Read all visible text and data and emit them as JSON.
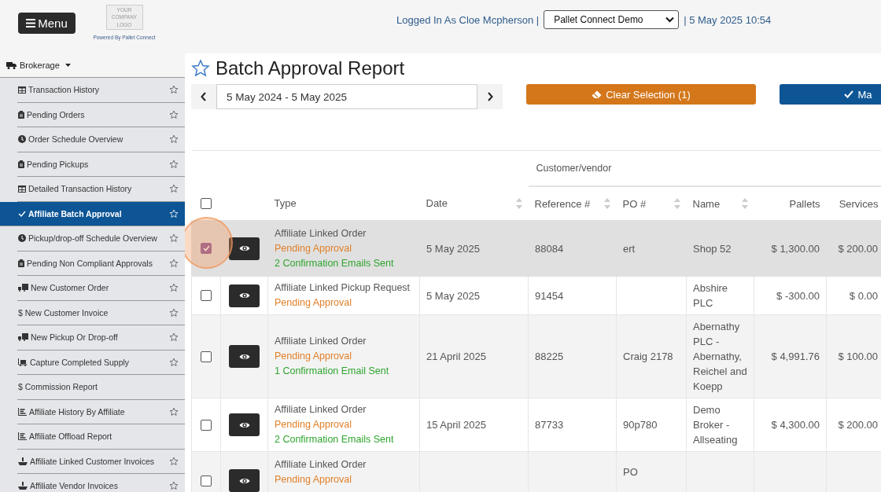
{
  "header": {
    "menu_button": "Menu",
    "logo": "YOUR COMPANY LOGO",
    "powered_by": "Powered By Pallet Connect",
    "logged_in": "Logged In As Cloe Mcpherson |",
    "company_select": "Pallet Connect Demo",
    "datetime": "| 5 May 2025 10:54"
  },
  "sidebar": {
    "section": "Brokerage",
    "items": [
      {
        "label": "Transaction History",
        "kind": "table",
        "star": true,
        "selected": false
      },
      {
        "label": "Pending Orders",
        "kind": "clipboard",
        "star": true,
        "selected": false
      },
      {
        "label": "Order Schedule Overview",
        "kind": "clock",
        "star": true,
        "selected": false
      },
      {
        "label": "Pending Pickups",
        "kind": "clipboard",
        "star": true,
        "selected": false
      },
      {
        "label": "Detailed Transaction History",
        "kind": "table",
        "star": true,
        "selected": false
      },
      {
        "label": "Affiliate Batch Approval",
        "kind": "check",
        "star": true,
        "selected": true
      },
      {
        "label": "Pickup/drop-off Schedule Overview",
        "kind": "clock",
        "star": true,
        "selected": false
      },
      {
        "label": "Pending Non Compliant Approvals",
        "kind": "clipboard",
        "star": true,
        "selected": false
      },
      {
        "label": "New Customer Order",
        "kind": "truck",
        "star": true,
        "selected": false
      },
      {
        "label": "$ New Customer Invoice",
        "kind": "plain",
        "star": true,
        "selected": false
      },
      {
        "label": "New Pickup Or Drop-off",
        "kind": "truck",
        "star": true,
        "selected": false
      },
      {
        "label": "Capture Completed Supply",
        "kind": "cart",
        "star": true,
        "selected": false
      },
      {
        "label": "$ Commission Report",
        "kind": "plain",
        "star": false,
        "selected": false
      },
      {
        "label": "Affiliate History By Affiliate",
        "kind": "chart",
        "star": true,
        "selected": false
      },
      {
        "label": "Affiliate Offload Report",
        "kind": "chart",
        "star": false,
        "selected": false
      },
      {
        "label": "Affiliate Linked Customer Invoices",
        "kind": "ship",
        "star": true,
        "selected": false
      },
      {
        "label": "Affiliate Vendor Invoices",
        "kind": "ship",
        "star": true,
        "selected": false
      }
    ]
  },
  "title": "Batch Approval Report",
  "date_range": "5 May 2024 - 5 May 2025",
  "buttons": [
    {
      "label": "Clear Selection (1)",
      "kind": "clear"
    },
    {
      "label": "Ma",
      "kind": "mark"
    }
  ],
  "table": {
    "group_header": "Customer/vendor",
    "select_all": {
      "checked": false
    },
    "columns": [
      {
        "label": "Type",
        "sortable": false
      },
      {
        "label": "Date",
        "sortable": true
      },
      {
        "label": "Reference #",
        "sortable": true
      },
      {
        "label": "PO #",
        "sortable": true
      },
      {
        "label": "Name",
        "sortable": true
      },
      {
        "label": "Pallets",
        "sortable": false
      },
      {
        "label": "Services",
        "sortable": false
      }
    ],
    "rows": [
      {
        "selected": true,
        "cells": [
          [
            {
              "text": "Affiliate Linked Order",
              "kind": "type"
            },
            {
              "text": "Pending Approval",
              "kind": "status"
            },
            {
              "text": "2 Confirmation Emails Sent",
              "kind": "emails"
            }
          ],
          "5 May 2025",
          "88084",
          "ert",
          "Shop 52",
          "$ 1,300.00",
          "$ 200.00"
        ]
      },
      {
        "selected": false,
        "cells": [
          [
            {
              "text": "Affiliate Linked Pickup Request",
              "kind": "type"
            },
            {
              "text": "Pending Approval",
              "kind": "status"
            }
          ],
          "5 May 2025",
          "91454",
          "",
          "Abshire PLC",
          "$ -300.00",
          "$ 0.00"
        ]
      },
      {
        "selected": false,
        "cells": [
          [
            {
              "text": "Affiliate Linked Order",
              "kind": "type"
            },
            {
              "text": "Pending Approval",
              "kind": "status"
            },
            {
              "text": "1 Confirmation Email Sent",
              "kind": "emails"
            }
          ],
          "21 April 2025",
          "88225",
          "Craig 2178",
          "Abernathy PLC - Abernathy, Reichel and Koepp",
          "$ 4,991.76",
          "$ 100.00"
        ]
      },
      {
        "selected": false,
        "cells": [
          [
            {
              "text": "Affiliate Linked Order",
              "kind": "type"
            },
            {
              "text": "Pending Approval",
              "kind": "status"
            },
            {
              "text": "2 Confirmation Emails Sent",
              "kind": "emails"
            }
          ],
          "15 April 2025",
          "87733",
          "90p780",
          "Demo Broker - Allseating",
          "$ 4,300.00",
          "$ 200.00"
        ]
      },
      {
        "selected": false,
        "cells": [
          [
            {
              "text": "Affiliate Linked Order",
              "kind": "type"
            },
            {
              "text": "Pending Approval",
              "kind": "status"
            }
          ],
          "",
          "",
          "PO",
          "",
          "",
          ""
        ]
      }
    ]
  }
}
